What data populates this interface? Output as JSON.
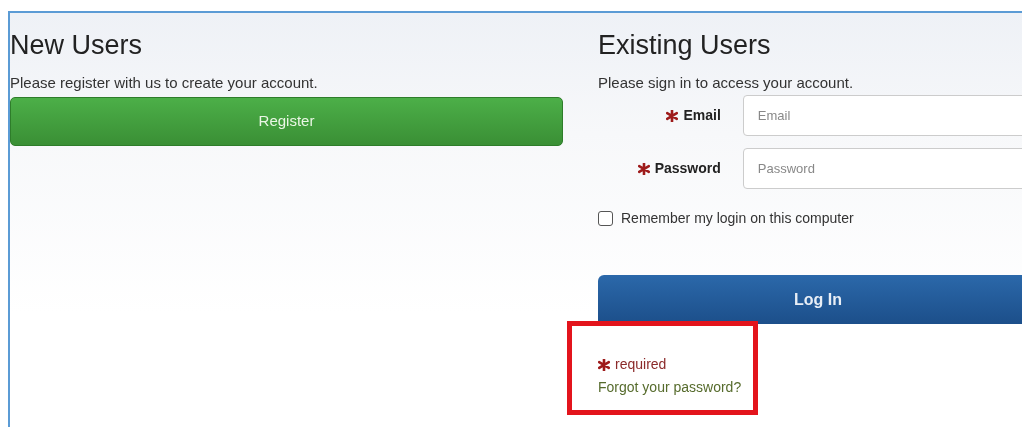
{
  "new_users": {
    "title": "New Users",
    "text": "Please register with us to create your account.",
    "button": "Register"
  },
  "existing_users": {
    "title": "Existing Users",
    "text": "Please sign in to access your account.",
    "fields": [
      {
        "label": "Email",
        "placeholder": "Email",
        "required": true
      },
      {
        "label": "Password",
        "placeholder": "Password",
        "required": true
      }
    ],
    "remember": {
      "label": "Remember my login on this computer",
      "checked": false
    },
    "button": "Log In",
    "help": {
      "highlighted": true,
      "required_note": "required",
      "forgot_link": "Forgot your password?"
    }
  }
}
